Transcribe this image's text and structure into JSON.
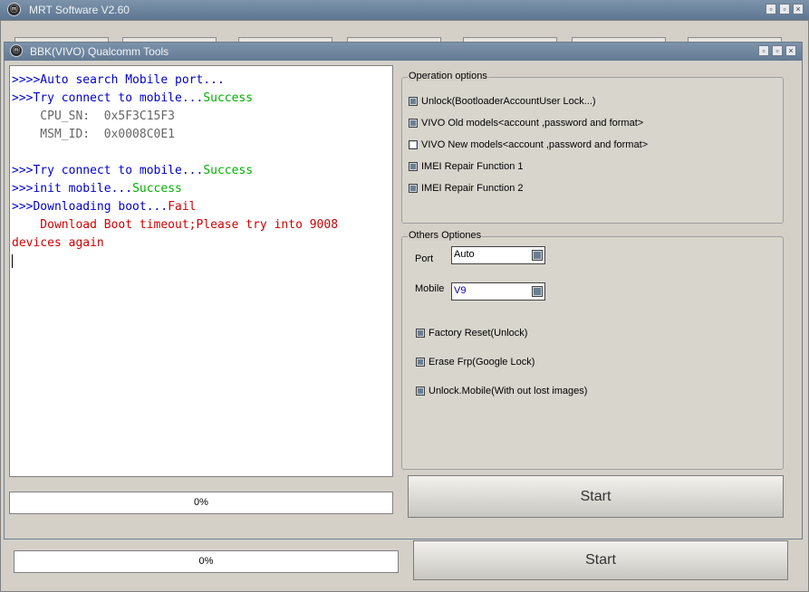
{
  "outer_window": {
    "title": "MRT Software V2.60",
    "icon": "mrt-logo-icon",
    "controls": [
      "minimize",
      "maximize",
      "close"
    ],
    "progress_text": "0%",
    "start_label": "Start"
  },
  "inner_window": {
    "title": "BBK(VIVO) Qualcomm Tools",
    "icon": "mrt-logo-icon"
  },
  "log": {
    "lines": [
      {
        "segments": [
          {
            "text": ">>>>Auto search Mobile port...",
            "color": "blue"
          }
        ]
      },
      {
        "segments": [
          {
            "text": ">>>Try connect to mobile...",
            "color": "blue"
          },
          {
            "text": "Success",
            "color": "green"
          }
        ]
      },
      {
        "segments": [
          {
            "text": "    CPU_SN:  0x5F3C15F3",
            "color": "gray"
          }
        ]
      },
      {
        "segments": [
          {
            "text": "    MSM_ID:  0x0008C0E1",
            "color": "gray"
          }
        ]
      },
      {
        "segments": [
          {
            "text": "",
            "color": "blue"
          }
        ]
      },
      {
        "segments": [
          {
            "text": ">>>Try connect to mobile...",
            "color": "blue"
          },
          {
            "text": "Success",
            "color": "green"
          }
        ]
      },
      {
        "segments": [
          {
            "text": ">>>init mobile...",
            "color": "blue"
          },
          {
            "text": "Success",
            "color": "green"
          }
        ]
      },
      {
        "segments": [
          {
            "text": ">>>Downloading boot...",
            "color": "blue"
          },
          {
            "text": "Fail",
            "color": "red"
          }
        ]
      },
      {
        "segments": [
          {
            "text": "    Download Boot timeout;Please try into 9008",
            "color": "red"
          }
        ]
      },
      {
        "segments": [
          {
            "text": "devices again",
            "color": "red"
          }
        ]
      }
    ]
  },
  "inner_progress_text": "0%",
  "inner_progress": 0,
  "outer_progress": 0,
  "operation_options": {
    "legend": "Operation options",
    "items": [
      {
        "label": "Unlock(BootloaderAccountUser Lock...)",
        "checked": false
      },
      {
        "label": "VIVO Old models<account ,password and format>",
        "checked": false
      },
      {
        "label": "VIVO New models<account ,password and format>",
        "checked": true
      },
      {
        "label": "IMEI Repair Function 1",
        "checked": false
      },
      {
        "label": "IMEI Repair Function 2",
        "checked": false
      }
    ]
  },
  "others_options": {
    "legend": "Others Optiones",
    "port_label": "Port",
    "port_value": "Auto",
    "mobile_label": "Mobile",
    "mobile_value": "V9",
    "items": [
      {
        "label": "Factory Reset(Unlock)",
        "checked": false
      },
      {
        "label": "Erase Frp(Google Lock)",
        "checked": false
      },
      {
        "label": "Unlock.Mobile(With out lost images)",
        "checked": false
      }
    ]
  },
  "inner_start_label": "Start",
  "colors": {
    "blue": "#0000cc",
    "green": "#00b000",
    "red": "#d10000",
    "gray": "#666666",
    "titlebar": "#6a829b"
  }
}
